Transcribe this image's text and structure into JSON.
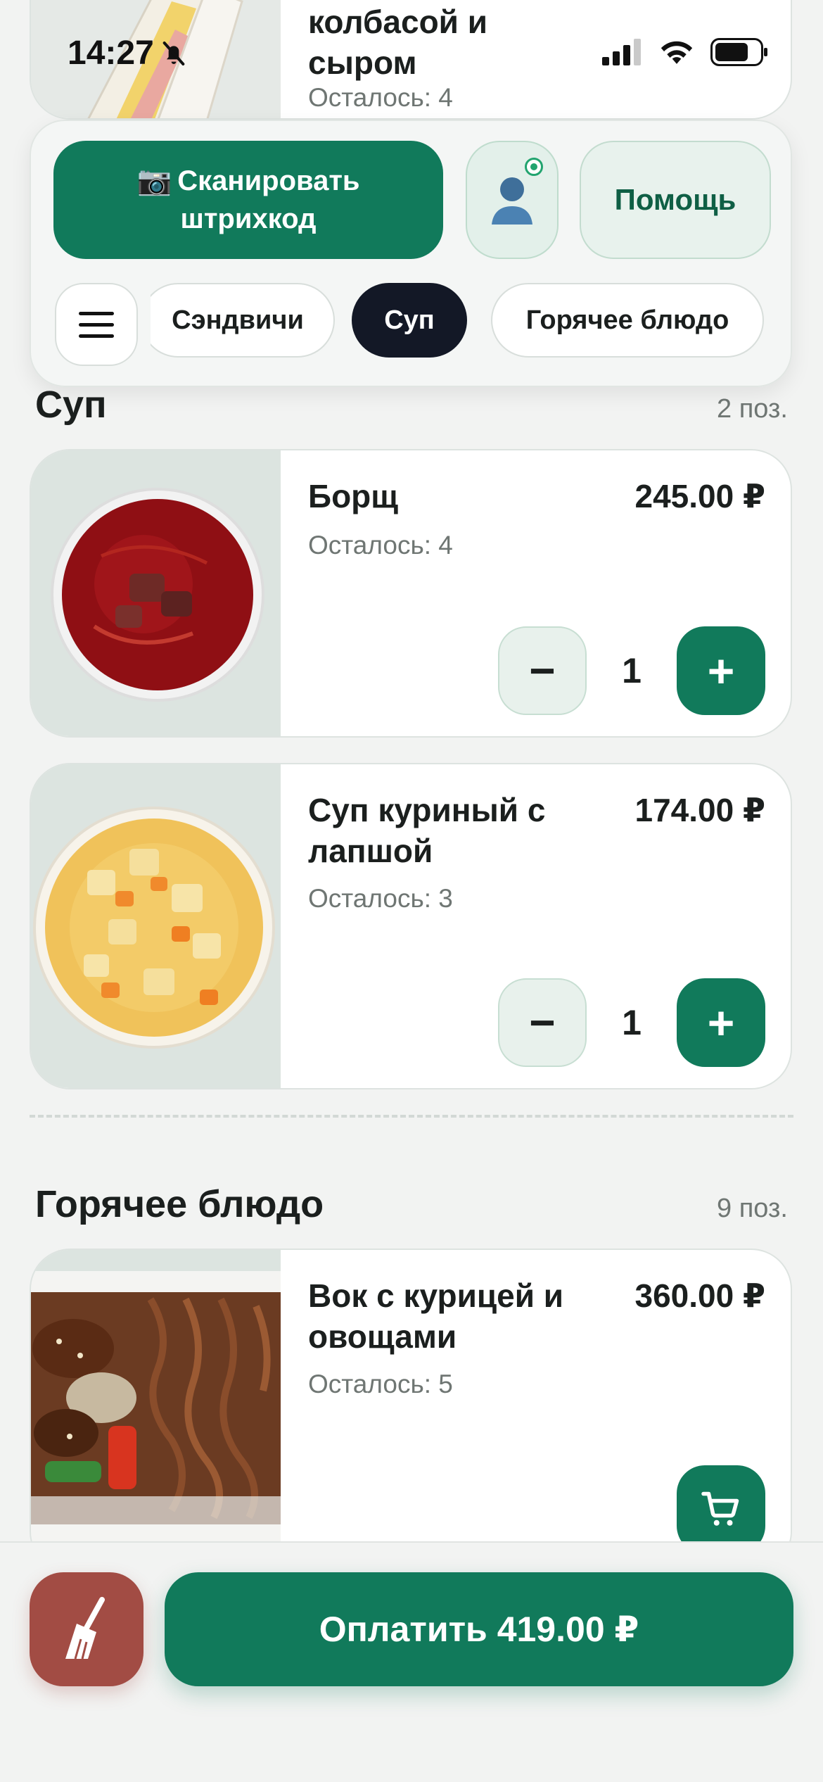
{
  "status_bar": {
    "time": "14:27"
  },
  "colors": {
    "accent": "#117a5b",
    "active_chip": "#131826",
    "clear": "#a24c44"
  },
  "header": {
    "scan_button": {
      "icon": "camera-icon",
      "line1": "Сканировать",
      "line2": "штрихкод"
    },
    "profile_button": {
      "icon": "user-icon"
    },
    "help_button": "Помощь",
    "menu_button": {
      "icon": "hamburger-icon"
    },
    "chips": [
      {
        "label": "Сэндвичи",
        "active": false
      },
      {
        "label": "Суп",
        "active": true
      },
      {
        "label": "Горячее блюдо",
        "active": false
      }
    ]
  },
  "prev_item": {
    "name_line1": "колбасой и",
    "name_line2": "сыром",
    "stock": "Осталось: 4"
  },
  "sections": [
    {
      "title": "Суп",
      "count": "2 поз.",
      "items": [
        {
          "name": "Борщ",
          "price": "245.00 ₽",
          "stock": "Осталось: 4",
          "qty": "1",
          "minus": "−",
          "plus": "+"
        },
        {
          "name": "Суп куриный с лапшой",
          "price": "174.00 ₽",
          "stock": "Осталось: 3",
          "qty": "1",
          "minus": "−",
          "plus": "+"
        }
      ]
    },
    {
      "title": "Горячее блюдо",
      "count": "9 поз.",
      "items": [
        {
          "name": "Вок с курицей и овощами",
          "price": "360.00 ₽",
          "stock": "Осталось: 5",
          "action_icon": "cart-icon"
        }
      ]
    }
  ],
  "bottom": {
    "clear_icon": "broom-icon",
    "pay_label": "Оплатить 419.00 ₽"
  }
}
